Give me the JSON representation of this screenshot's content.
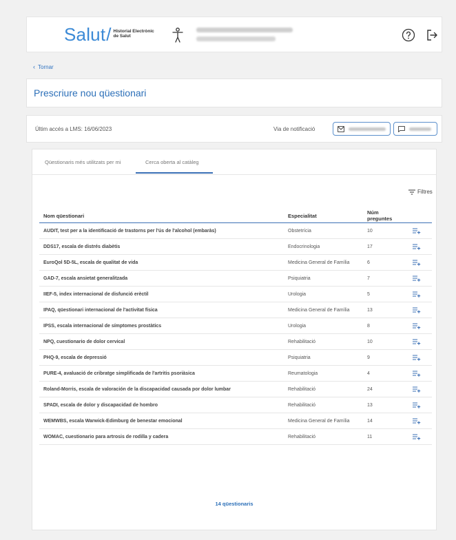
{
  "header": {
    "logo_word": "Salut",
    "logo_slash": "/",
    "logo_sub_line1": "Historial Electrònic",
    "logo_sub_line2": "de Salut",
    "help_icon": "help-circle-icon",
    "exit_icon": "logout-icon"
  },
  "nav": {
    "back_label": "Tornar"
  },
  "page": {
    "title": "Prescriure nou qüestionari"
  },
  "access": {
    "last_access": "Últim accés a LMS: 16/06/2023",
    "notification_label": "Via de notificació"
  },
  "tabs": [
    {
      "label": "Qüestionaris més utilitzats per mi",
      "active": false
    },
    {
      "label": "Cerca oberta al catàleg",
      "active": true
    }
  ],
  "filters_label": "Filtres",
  "table": {
    "headers": [
      "Nom qüestionari",
      "Especialitat",
      "Núm preguntes"
    ],
    "rows": [
      {
        "name": "AUDIT, test per a la identificació de trastorns per l'ús de l'alcohol (embaràs)",
        "specialty": "Obstetrícia",
        "questions": "10"
      },
      {
        "name": "DDS17, escala de distrés diabètis",
        "specialty": "Endocrinologia",
        "questions": "17"
      },
      {
        "name": "EuroQol 5D-5L, escala de qualitat de vida",
        "specialty": "Medicina General de Família",
        "questions": "6"
      },
      {
        "name": "GAD-7, escala ansietat generalitzada",
        "specialty": "Psiquiatria",
        "questions": "7"
      },
      {
        "name": "IIEF-5, index internacional de disfunció erèctil",
        "specialty": "Urologia",
        "questions": "5"
      },
      {
        "name": "IPAQ, qüestionari internacional de l'activitat física",
        "specialty": "Medicina General de Família",
        "questions": "13"
      },
      {
        "name": "IPSS, escala internacional de símptomes prostàtics",
        "specialty": "Urologia",
        "questions": "8"
      },
      {
        "name": "NPQ, cuestionario de dolor cervical",
        "specialty": "Rehabilitació",
        "questions": "10"
      },
      {
        "name": "PHQ-9, escala de depressió",
        "specialty": "Psiquiatria",
        "questions": "9"
      },
      {
        "name": "PURE-4, avaluació de cribratge simplificada de l'artritis psoriàsica",
        "specialty": "Reumatologia",
        "questions": "4"
      },
      {
        "name": "Roland-Morris, escala de valoración de la discapacidad causada por dolor lumbar",
        "specialty": "Rehabilitació",
        "questions": "24"
      },
      {
        "name": "SPADI, escala de dolor y discapacidad de hombro",
        "specialty": "Rehabilitació",
        "questions": "13"
      },
      {
        "name": "WEMWBS, escala Warwick-Edimburg de benestar emocional",
        "specialty": "Medicina General de Família",
        "questions": "14"
      },
      {
        "name": "WOMAC, cuestionario para artrosis de rodilla y cadera",
        "specialty": "Rehabilitació",
        "questions": "11"
      }
    ]
  },
  "count_label": "14 qüestionaris",
  "colors": {
    "brand_blue": "#3c8ad6",
    "link_blue": "#2b6fb8",
    "accent_line": "#3a6fb5"
  }
}
